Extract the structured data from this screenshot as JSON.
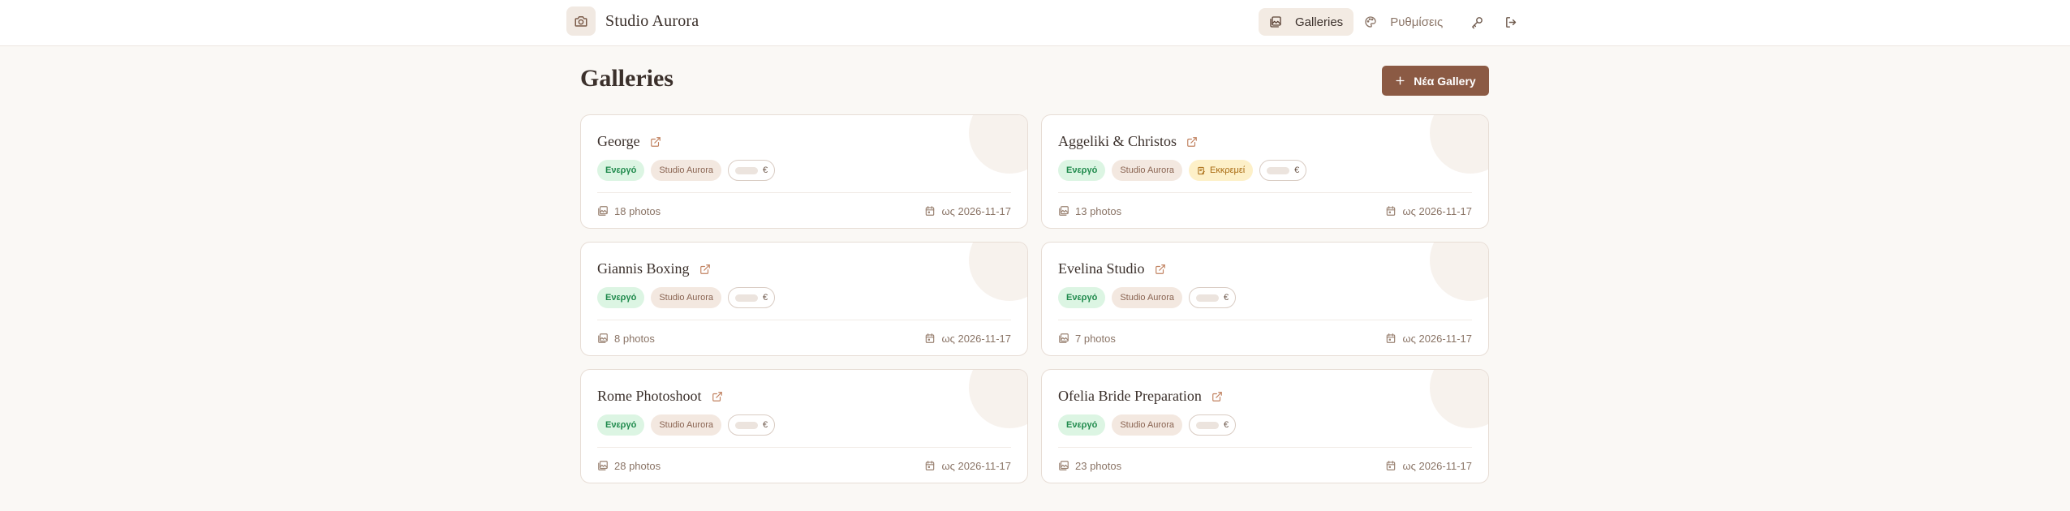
{
  "app": {
    "brand_name": "Studio Aurora",
    "brand_icon": "camera-icon"
  },
  "nav": {
    "galleries_label": "Galleries",
    "settings_label": "Ρυθμίσεις",
    "key_icon": "key-icon",
    "logout_icon": "logout-icon"
  },
  "page": {
    "title": "Galleries",
    "new_button_label": "Νέα Gallery"
  },
  "colors": {
    "accent": "#8b5a44",
    "background": "#faf8f5",
    "status_active_bg": "#dcf5e3",
    "status_active_text": "#1f8a4c",
    "pending_bg": "#fdf0c8",
    "pending_text": "#a86a10"
  },
  "galleries": [
    {
      "name": "George",
      "status": "Ενεργό",
      "studio": "Studio Aurora",
      "pending": null,
      "currency": "€",
      "photos": "18 photos",
      "expires": "ως 2026-11-17"
    },
    {
      "name": "Aggeliki & Christos",
      "status": "Ενεργό",
      "studio": "Studio Aurora",
      "pending": "Εκκρεμεί",
      "currency": "€",
      "photos": "13 photos",
      "expires": "ως 2026-11-17"
    },
    {
      "name": "Giannis Boxing",
      "status": "Ενεργό",
      "studio": "Studio Aurora",
      "pending": null,
      "currency": "€",
      "photos": "8 photos",
      "expires": "ως 2026-11-17"
    },
    {
      "name": "Evelina Studio",
      "status": "Ενεργό",
      "studio": "Studio Aurora",
      "pending": null,
      "currency": "€",
      "photos": "7 photos",
      "expires": "ως 2026-11-17"
    },
    {
      "name": "Rome Photoshoot",
      "status": "Ενεργό",
      "studio": "Studio Aurora",
      "pending": null,
      "currency": "€",
      "photos": "28 photos",
      "expires": "ως 2026-11-17"
    },
    {
      "name": "Ofelia Bride Preparation",
      "status": "Ενεργό",
      "studio": "Studio Aurora",
      "pending": null,
      "currency": "€",
      "photos": "23 photos",
      "expires": "ως 2026-11-17"
    }
  ]
}
